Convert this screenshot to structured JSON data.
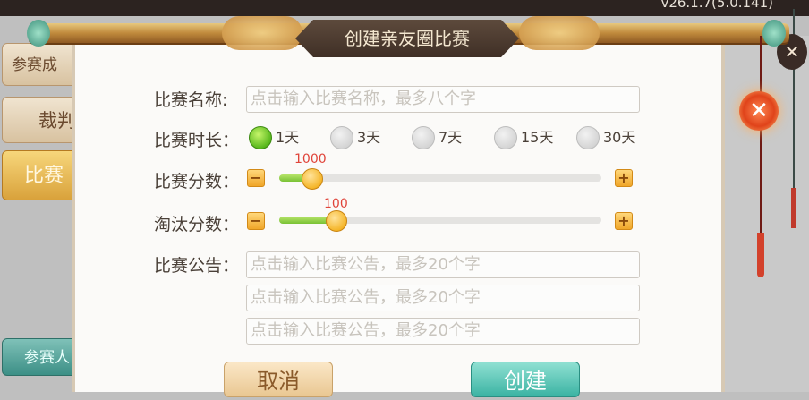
{
  "app": {
    "version": "v26.1.7(5.0.141)"
  },
  "background": {
    "left_buttons": [
      "参赛成",
      "裁判",
      "比赛",
      "参赛人"
    ],
    "right_text": "比赛"
  },
  "dialog": {
    "title": "创建亲友圈比赛",
    "match_name": {
      "label": "比赛名称:",
      "placeholder": "点击输入比赛名称，最多八个字"
    },
    "duration": {
      "label": "比赛时长：",
      "options": [
        "1天",
        "3天",
        "7天",
        "15天",
        "30天"
      ],
      "selected": "1天"
    },
    "match_score": {
      "label": "比赛分数：",
      "value": "1000",
      "min_label": "−",
      "plus_label": "+"
    },
    "elim_score": {
      "label": "淘汰分数：",
      "value": "100",
      "min_label": "−",
      "plus_label": "+"
    },
    "notice": {
      "label": "比赛公告：",
      "placeholders": [
        "点击输入比赛公告，最多20个字",
        "点击输入比赛公告，最多20个字",
        "点击输入比赛公告，最多20个字"
      ]
    },
    "buttons": {
      "cancel": "取消",
      "create": "创建"
    }
  },
  "icons": {
    "close": "close-icon"
  },
  "colors": {
    "accent_green": "#58b81c",
    "create_teal": "#3bb3a3",
    "cancel_beige": "#e9c792",
    "slider_value": "#e0443a"
  }
}
